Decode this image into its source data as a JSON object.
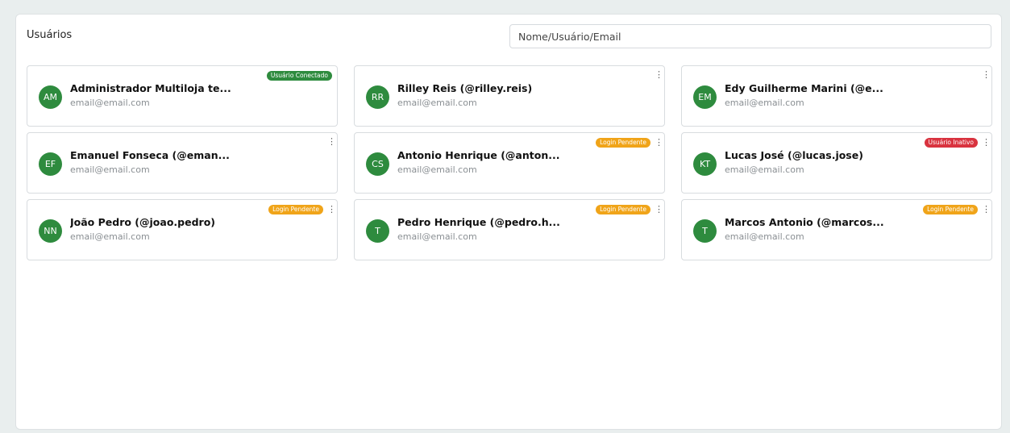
{
  "header": {
    "title": "Usuários",
    "search_placeholder": "Nome/Usuário/Email",
    "search_value": ""
  },
  "colors": {
    "avatar": "#2e8b3e",
    "badge_connected": "#2e8b3e",
    "badge_pending": "#f0a419",
    "badge_inactive": "#d9333f"
  },
  "users": [
    {
      "initials": "AM",
      "name": "Administrador Multiloja te...",
      "email": "email@email.com",
      "badge": "Usuário Conectado",
      "badge_type": "connected",
      "menu": false
    },
    {
      "initials": "RR",
      "name": "Rilley Reis (@rilley.reis)",
      "email": "email@email.com",
      "badge": "",
      "badge_type": "",
      "menu": true
    },
    {
      "initials": "EM",
      "name": "Edy Guilherme Marini (@e...",
      "email": "email@email.com",
      "badge": "",
      "badge_type": "",
      "menu": true
    },
    {
      "initials": "EF",
      "name": "Emanuel Fonseca (@eman...",
      "email": "email@email.com",
      "badge": "",
      "badge_type": "",
      "menu": true
    },
    {
      "initials": "CS",
      "name": "Antonio Henrique (@anton...",
      "email": "email@email.com",
      "badge": "Login Pendente",
      "badge_type": "pending",
      "menu": true
    },
    {
      "initials": "KT",
      "name": "Lucas José (@lucas.jose)",
      "email": "email@email.com",
      "badge": "Usuário Inativo",
      "badge_type": "inactive",
      "menu": true
    },
    {
      "initials": "NN",
      "name": "João Pedro (@joao.pedro)",
      "email": "email@email.com",
      "badge": "Login Pendente",
      "badge_type": "pending",
      "menu": true
    },
    {
      "initials": "T",
      "name": "Pedro Henrique (@pedro.h...",
      "email": "email@email.com",
      "badge": "Login Pendente",
      "badge_type": "pending",
      "menu": true
    },
    {
      "initials": "T",
      "name": "Marcos Antonio (@marcos...",
      "email": "email@email.com",
      "badge": "Login Pendente",
      "badge_type": "pending",
      "menu": true
    }
  ],
  "icons": {
    "menu": "more-vertical-icon",
    "menu_glyph": "⋮"
  }
}
